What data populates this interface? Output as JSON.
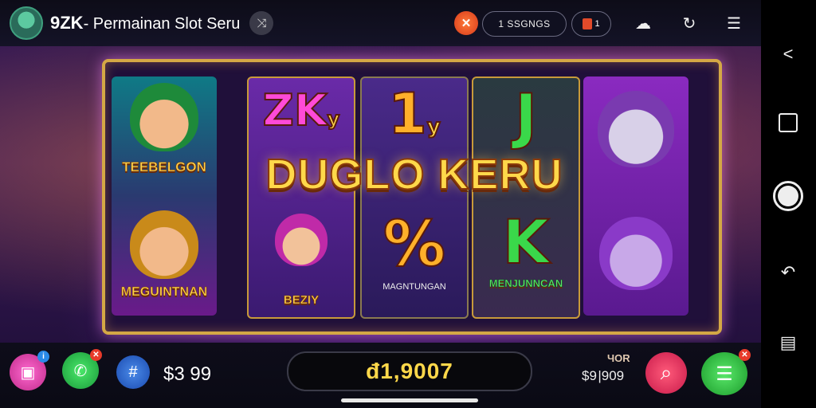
{
  "header": {
    "brand": "9ZK",
    "title": "- Permainan Slot Seru",
    "status_text": "1 SSGNGS",
    "bag_count": "1"
  },
  "reels": {
    "r1_top_label": "TEEBELGON",
    "r1_bottom_label": "MEGUINTNAN",
    "r2_top_glyph": "ZK",
    "r2_top_small": "y",
    "r2_bottom_label": "BEZIY",
    "r3_top_glyph": "1",
    "r3_top_small": "y",
    "r3_bottom_glyph": "%",
    "r3_bottom_label": "MAGNTUNGAN",
    "r4_top_glyph": "J",
    "r4_bottom_glyph": "K",
    "r4_bottom_label": "MENJUNNCAN"
  },
  "overlay_title": "DUGLO KERU",
  "footer": {
    "balance": "$3 99",
    "win_amount": "đ1,9007",
    "bet_label": "ЧOR",
    "bet_value": "$9 |909"
  },
  "colors": {
    "accent_gold": "#ffd84a",
    "frame_gold": "#d4a845",
    "search_button": "#e8325a",
    "menu_button": "#2eb84a"
  }
}
